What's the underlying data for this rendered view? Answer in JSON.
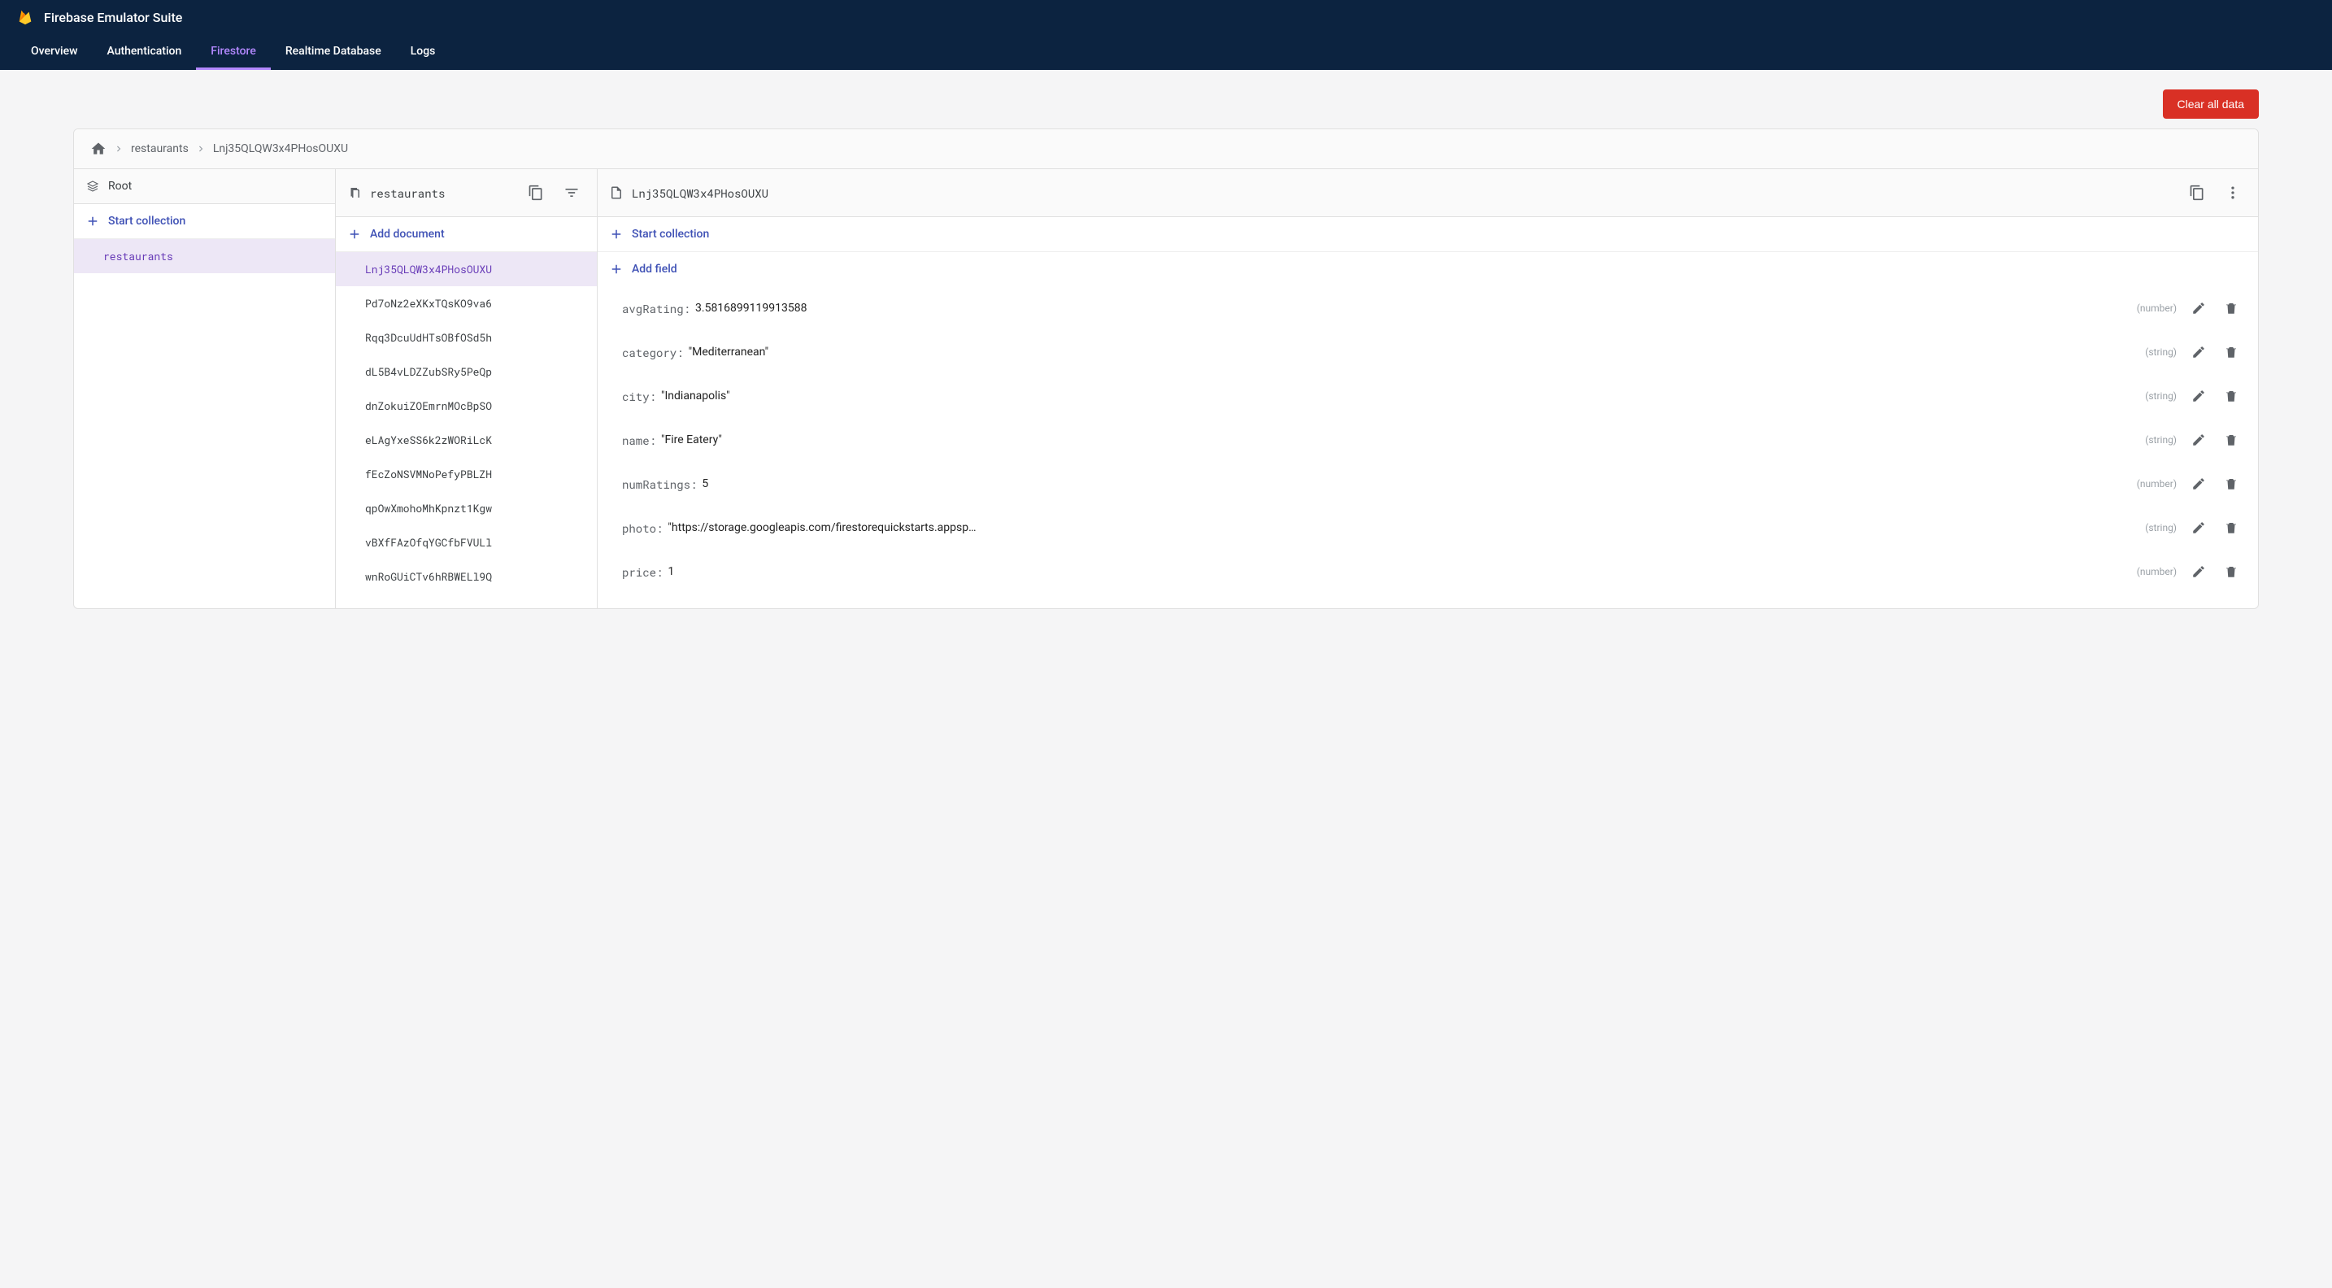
{
  "header": {
    "title": "Firebase Emulator Suite",
    "tabs": [
      {
        "label": "Overview",
        "active": false
      },
      {
        "label": "Authentication",
        "active": false
      },
      {
        "label": "Firestore",
        "active": true
      },
      {
        "label": "Realtime Database",
        "active": false
      },
      {
        "label": "Logs",
        "active": false
      }
    ]
  },
  "toolbar": {
    "clear_label": "Clear all data"
  },
  "breadcrumb": {
    "items": [
      "restaurants",
      "Lnj35QLQW3x4PHosOUXU"
    ]
  },
  "col_root": {
    "header": "Root",
    "action": "Start collection",
    "items": [
      {
        "label": "restaurants",
        "selected": true
      }
    ]
  },
  "col_collection": {
    "header": "restaurants",
    "action": "Add document",
    "items": [
      {
        "label": "Lnj35QLQW3x4PHosOUXU",
        "selected": true
      },
      {
        "label": "Pd7oNz2eXKxTQsKO9va6",
        "selected": false
      },
      {
        "label": "Rqq3DcuUdHTsOBfOSd5h",
        "selected": false
      },
      {
        "label": "dL5B4vLDZZubSRy5PeQp",
        "selected": false
      },
      {
        "label": "dnZokuiZOEmrnMOcBpSO",
        "selected": false
      },
      {
        "label": "eLAgYxeSS6k2zWORiLcK",
        "selected": false
      },
      {
        "label": "fEcZoNSVMNoPefyPBLZH",
        "selected": false
      },
      {
        "label": "qpOwXmohoMhKpnzt1Kgw",
        "selected": false
      },
      {
        "label": "vBXfFAzOfqYGCfbFVULl",
        "selected": false
      },
      {
        "label": "wnRoGUiCTv6hRBWELl9Q",
        "selected": false
      }
    ]
  },
  "col_document": {
    "header": "Lnj35QLQW3x4PHosOUXU",
    "action_collection": "Start collection",
    "action_field": "Add field",
    "fields": [
      {
        "key": "avgRating",
        "value": "3.5816899119913588",
        "type": "number",
        "quoted": false
      },
      {
        "key": "category",
        "value": "Mediterranean",
        "type": "string",
        "quoted": true
      },
      {
        "key": "city",
        "value": "Indianapolis",
        "type": "string",
        "quoted": true
      },
      {
        "key": "name",
        "value": "Fire Eatery",
        "type": "string",
        "quoted": true
      },
      {
        "key": "numRatings",
        "value": "5",
        "type": "number",
        "quoted": false
      },
      {
        "key": "photo",
        "value": "https://storage.googleapis.com/firestorequickstarts.appspot.…",
        "type": "string",
        "quoted": true
      },
      {
        "key": "price",
        "value": "1",
        "type": "number",
        "quoted": false
      }
    ]
  }
}
